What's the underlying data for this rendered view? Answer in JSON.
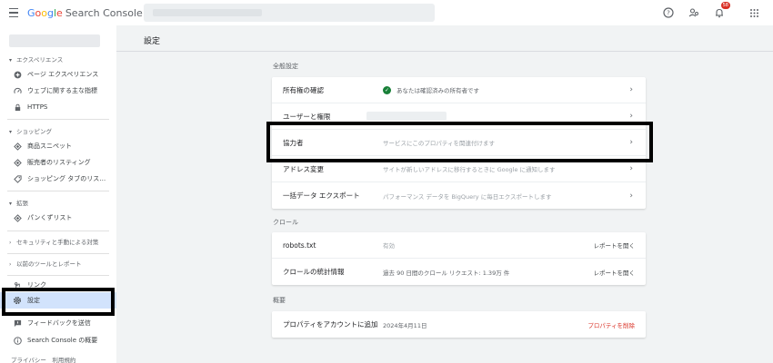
{
  "app": {
    "product_name": "Search Console",
    "google_letters": [
      "G",
      "o",
      "o",
      "g",
      "l",
      "e"
    ],
    "notification_count": "58"
  },
  "sidebar": {
    "sections": [
      {
        "label": "エクスペリエンス",
        "items": [
          {
            "label": "ページ エクスペリエンス",
            "icon": "plus-circle-icon"
          },
          {
            "label": "ウェブに関する主な指標",
            "icon": "speed-icon"
          },
          {
            "label": "HTTPS",
            "icon": "lock-icon"
          }
        ]
      },
      {
        "label": "ショッピング",
        "items": [
          {
            "label": "商品スニペット",
            "icon": "diamond-icon"
          },
          {
            "label": "販売者のリスティング",
            "icon": "diamond-icon"
          },
          {
            "label": "ショッピング タブのリス…",
            "icon": "tag-icon"
          }
        ]
      },
      {
        "label": "拡張",
        "items": [
          {
            "label": "パンくずリスト",
            "icon": "diamond-icon"
          }
        ]
      },
      {
        "label": "セキュリティと手動による対策",
        "items": []
      },
      {
        "label": "以前のツールとレポート",
        "items": []
      }
    ],
    "bottom_items": [
      {
        "label": "リンク",
        "icon": "link-icon"
      },
      {
        "label": "設定",
        "icon": "gear-icon"
      },
      {
        "label": "フィードバックを送信",
        "icon": "feedback-icon"
      },
      {
        "label": "Search Console の概要",
        "icon": "info-icon"
      }
    ],
    "footer": "プライバシー　利用規約"
  },
  "main": {
    "title": "設定",
    "general": {
      "label": "全般設定",
      "rows": [
        {
          "label": "所有権の確認",
          "desc": "あなたは確認済みの所有者です"
        },
        {
          "label": "ユーザーと権限",
          "desc": ""
        },
        {
          "label": "協力者",
          "desc": "サービスにこのプロパティを関連付けます"
        },
        {
          "label": "アドレス変更",
          "desc": "サイトが新しいアドレスに移行するときに Google に通知します"
        },
        {
          "label": "一括データ エクスポート",
          "desc": "パフォーマンス データを BigQuery に毎日エクスポートします"
        }
      ]
    },
    "crawl": {
      "label": "クロール",
      "rows": [
        {
          "label": "robots.txt",
          "desc": "有効",
          "action": "レポートを開く"
        },
        {
          "label": "クロールの統計情報",
          "desc": "過去 90 日間のクロール リクエスト: 1.39万 件",
          "action": "レポートを開く"
        }
      ]
    },
    "about": {
      "label": "概要",
      "rows": [
        {
          "label": "プロパティをアカウントに追加",
          "desc": "2024年4月11日",
          "action": "プロパティを削除"
        }
      ]
    }
  },
  "colors": {
    "accent": "#1a73e8",
    "active_bg": "#d2e3fc",
    "danger": "#d93025",
    "success": "#188038"
  }
}
